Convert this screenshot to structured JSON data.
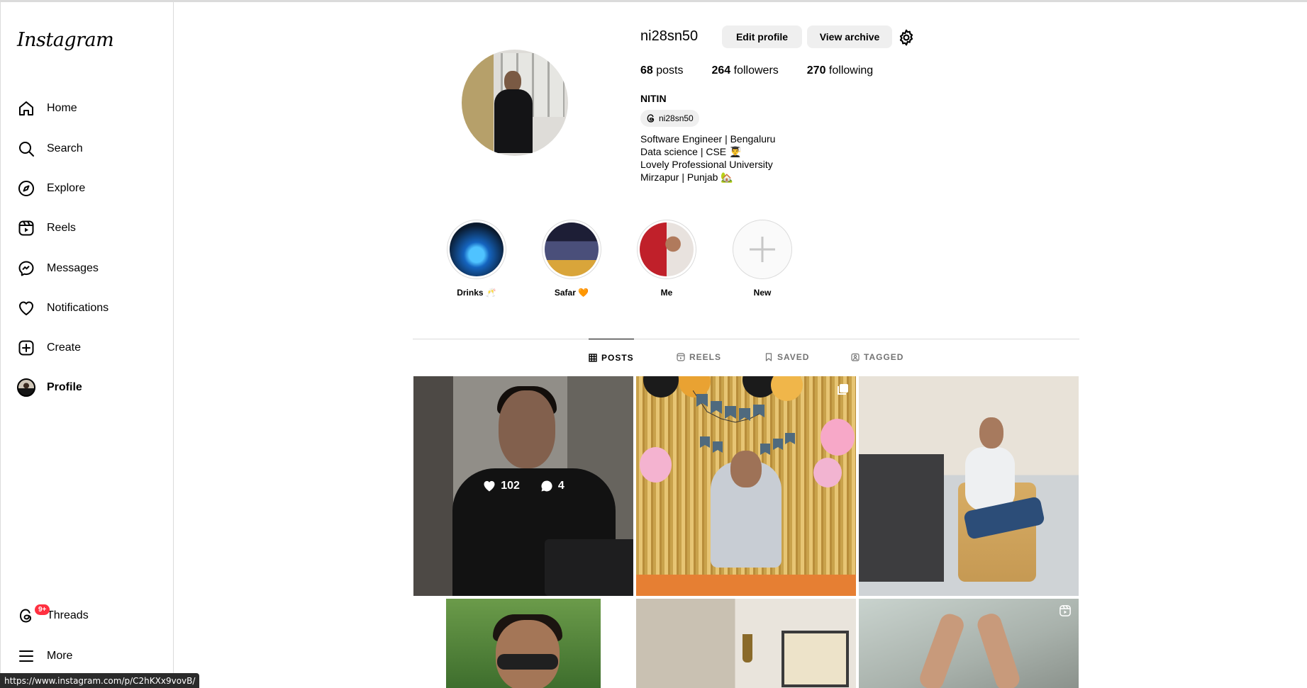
{
  "app": {
    "logo_text": "Instagram"
  },
  "sidebar": {
    "items": [
      {
        "label": "Home",
        "icon": "home-icon"
      },
      {
        "label": "Search",
        "icon": "search-icon"
      },
      {
        "label": "Explore",
        "icon": "compass-icon"
      },
      {
        "label": "Reels",
        "icon": "reels-icon"
      },
      {
        "label": "Messages",
        "icon": "messenger-icon"
      },
      {
        "label": "Notifications",
        "icon": "heart-icon"
      },
      {
        "label": "Create",
        "icon": "plus-square-icon"
      },
      {
        "label": "Profile",
        "icon": "avatar",
        "active": true
      }
    ],
    "bottom": [
      {
        "label": "Threads",
        "icon": "threads-icon",
        "badge": "9+"
      },
      {
        "label": "More",
        "icon": "menu-icon"
      }
    ]
  },
  "profile": {
    "username": "ni28sn50",
    "edit_label": "Edit profile",
    "archive_label": "View archive",
    "stats": {
      "posts_count": "68",
      "posts_label": " posts",
      "followers_count": "264",
      "followers_label": " followers",
      "following_count": "270",
      "following_label": " following"
    },
    "full_name": "NITIN",
    "threads_handle": "ni28sn50",
    "bio": [
      "Software Engineer | Bengaluru",
      "Data science | CSE 👨‍🎓",
      "Lovely Professional University",
      "Mirzapur | Punjab 🏡"
    ]
  },
  "highlights": [
    {
      "caption": "Drinks 🥂"
    },
    {
      "caption": "Safar 🧡"
    },
    {
      "caption": "Me"
    },
    {
      "caption": "New"
    }
  ],
  "tabs": [
    {
      "label": "POSTS",
      "active": true
    },
    {
      "label": "REELS"
    },
    {
      "label": "SAVED"
    },
    {
      "label": "TAGGED"
    }
  ],
  "posts": {
    "hovered": {
      "likes": "102",
      "comments": "4"
    }
  },
  "status_url": "https://www.instagram.com/p/C2hKXx9vovB/"
}
